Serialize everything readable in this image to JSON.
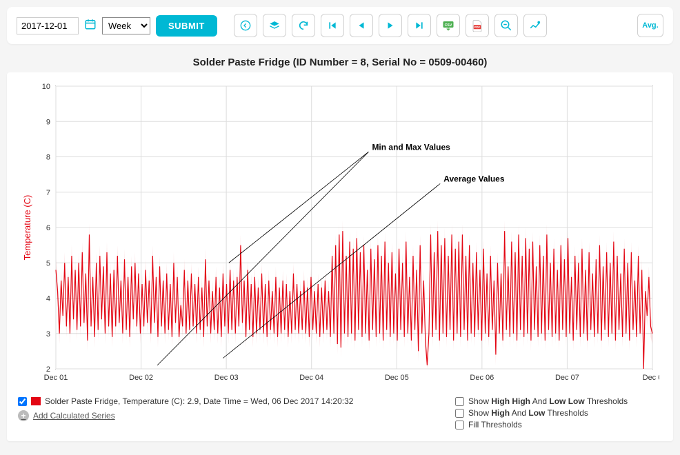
{
  "toolbar": {
    "date_value": "2017-12-01",
    "period_value": "Week",
    "period_options": [
      "Week"
    ],
    "submit_label": "SUBMIT",
    "avg_label": "Avg."
  },
  "chart_title": "Solder Paste Fridge (ID Number = 8, Serial No = 0509-00460)",
  "chart_data": {
    "type": "line",
    "title": "Solder Paste Fridge (ID Number = 8, Serial No = 0509-00460)",
    "xlabel": "",
    "ylabel": "Temperature (C)",
    "ylim": [
      2,
      10
    ],
    "y_ticks": [
      2,
      3,
      4,
      5,
      6,
      7,
      8,
      9,
      10
    ],
    "x_ticks": [
      "Dec 01",
      "Dec 02",
      "Dec 03",
      "Dec 04",
      "Dec 05",
      "Dec 06",
      "Dec 07",
      "Dec 0"
    ],
    "annotations": [
      {
        "label": "Min and Max Values",
        "x": 0.55,
        "y": 8.2
      },
      {
        "label": "Average Values",
        "x": 0.68,
        "y": 7.3
      }
    ],
    "series": [
      {
        "name": "Solder Paste Fridge, Temperature (C)",
        "color": "#e30613",
        "values": [
          4.8,
          4.2,
          3.0,
          4.5,
          3.5,
          5.0,
          3.2,
          4.6,
          3.0,
          5.2,
          3.4,
          4.8,
          3.1,
          5.0,
          3.2,
          5.3,
          3.3,
          4.7,
          2.8,
          5.8,
          3.2,
          4.6,
          2.9,
          5.0,
          3.1,
          5.2,
          3.4,
          4.9,
          3.0,
          5.3,
          3.2,
          4.7,
          2.9,
          4.8,
          3.2,
          5.2,
          3.3,
          4.5,
          3.0,
          5.1,
          3.1,
          4.6,
          2.9,
          4.9,
          3.4,
          5.0,
          3.2,
          4.7,
          3.0,
          4.4,
          3.2,
          4.8,
          3.3,
          4.5,
          3.0,
          5.2,
          3.3,
          4.6,
          2.9,
          4.9,
          3.2,
          4.5,
          3.0,
          4.7,
          3.1,
          4.4,
          2.9,
          5.0,
          3.3,
          4.6,
          2.9,
          3.8,
          3.2,
          4.8,
          3.0,
          4.5,
          3.1,
          4.7,
          3.2,
          4.4,
          3.0,
          4.6,
          3.1,
          4.3,
          2.9,
          5.1,
          3.2,
          4.5,
          3.0,
          4.2,
          3.1,
          4.6,
          3.0,
          4.3,
          2.9,
          4.7,
          3.2,
          4.4,
          3.0,
          4.8,
          3.1,
          4.5,
          3.0,
          4.6,
          3.2,
          5.5,
          3.3,
          4.5,
          2.9,
          4.8,
          3.1,
          4.4,
          2.9,
          4.6,
          3.0,
          4.3,
          3.1,
          4.7,
          3.0,
          4.4,
          2.9,
          4.5,
          3.1,
          4.2,
          3.0,
          4.6,
          2.9,
          4.3,
          3.0,
          4.5,
          3.1,
          4.4,
          2.9,
          4.2,
          3.0,
          4.7,
          3.1,
          4.4,
          3.0,
          4.2,
          3.1,
          4.5,
          3.0,
          4.3,
          2.9,
          4.6,
          3.1,
          4.2,
          3.0,
          4.4,
          2.9,
          4.3,
          3.0,
          4.5,
          3.1,
          4.2,
          2.9,
          5.2,
          3.0,
          5.5,
          2.7,
          5.8,
          2.6,
          5.9,
          3.0,
          5.2,
          2.9,
          5.6,
          3.0,
          5.4,
          2.8,
          5.7,
          3.1,
          5.3,
          2.9,
          5.5,
          3.0,
          4.8,
          2.8,
          5.4,
          3.1,
          5.1,
          2.9,
          5.5,
          3.0,
          5.2,
          2.8,
          5.6,
          3.1,
          5.0,
          2.9,
          5.3,
          3.0,
          4.7,
          2.8,
          5.4,
          3.1,
          5.0,
          2.9,
          5.6,
          3.0,
          4.6,
          2.8,
          5.2,
          3.1,
          4.8,
          2.5,
          5.5,
          3.0,
          4.5,
          2.8,
          2.1,
          3.0,
          5.8,
          2.9,
          5.3,
          3.1,
          5.9,
          2.8,
          5.5,
          3.0,
          5.7,
          2.9,
          5.2,
          3.1,
          5.8,
          2.8,
          5.4,
          3.0,
          5.6,
          2.9,
          5.8,
          3.1,
          5.2,
          2.8,
          5.5,
          3.0,
          5.0,
          2.9,
          5.3,
          3.1,
          4.8,
          2.8,
          5.4,
          3.0,
          4.7,
          2.9,
          5.2,
          3.1,
          4.5,
          2.4,
          5.0,
          3.0,
          4.7,
          2.8,
          5.9,
          3.1,
          4.9,
          2.9,
          5.6,
          3.0,
          5.3,
          2.8,
          5.8,
          3.1,
          5.2,
          2.9,
          5.7,
          3.0,
          5.4,
          2.8,
          5.6,
          3.1,
          4.9,
          2.9,
          5.5,
          3.0,
          5.2,
          2.8,
          5.8,
          3.1,
          5.0,
          2.9,
          5.4,
          3.0,
          4.8,
          2.8,
          5.5,
          3.1,
          5.1,
          2.9,
          5.7,
          3.0,
          4.6,
          2.8,
          5.2,
          3.1,
          5.0,
          2.9,
          5.4,
          3.0,
          4.8,
          2.8,
          5.3,
          3.1,
          4.7,
          2.9,
          5.1,
          3.0,
          5.5,
          2.8,
          4.9,
          3.1,
          5.3,
          2.9,
          5.0,
          3.0,
          5.6,
          2.8,
          5.2,
          3.1,
          4.7,
          2.9,
          5.4,
          3.0,
          5.0,
          2.8,
          5.3,
          3.1,
          4.5,
          2.9,
          5.2,
          3.0,
          4.8,
          2.0,
          4.2,
          3.5,
          4.6,
          3.2,
          3.0
        ]
      }
    ]
  },
  "legend": {
    "series_text": "Solder Paste Fridge, Temperature (C): 2.9, Date Time = Wed, 06 Dec 2017 14:20:32",
    "series_checked": true,
    "add_series_label": "Add Calculated Series"
  },
  "thresholds": {
    "hhll_label_pre": "Show ",
    "hhll_b1": "High High",
    "hhll_mid": " And ",
    "hhll_b2": "Low Low",
    "hhll_suf": " Thresholds",
    "hl_label_pre": "Show ",
    "hl_b1": "High",
    "hl_mid": " And ",
    "hl_b2": "Low",
    "hl_suf": " Thresholds",
    "fill_label": "Fill Thresholds"
  },
  "ylabel": "Temperature (C)",
  "ann1": "Min and Max Values",
  "ann2": "Average Values"
}
